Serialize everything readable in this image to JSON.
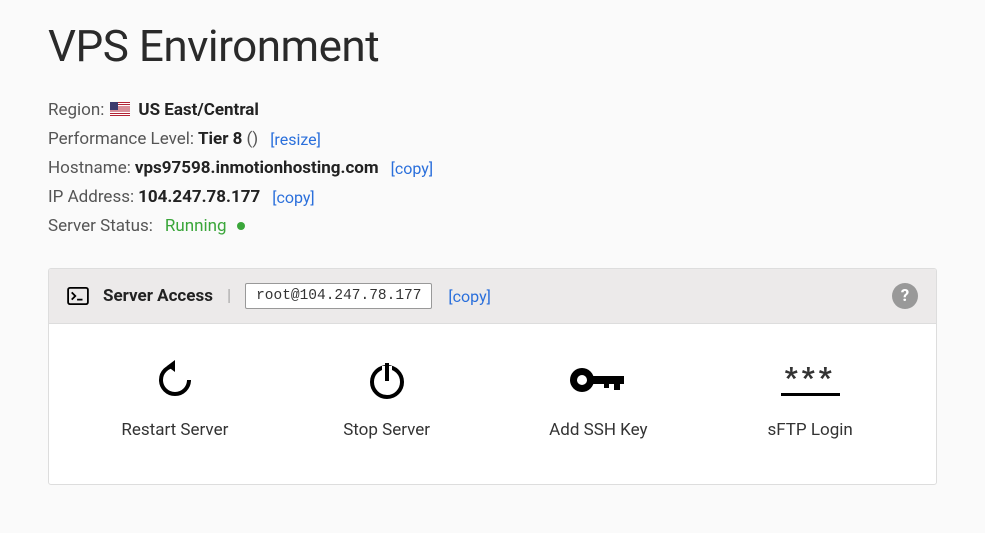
{
  "title": "VPS Environment",
  "details": {
    "region_label": "Region:",
    "region_value": "US East/Central",
    "perf_label": "Performance Level:",
    "perf_value": "Tier 8",
    "perf_extra": "()",
    "resize_link": "[resize]",
    "hostname_label": "Hostname:",
    "hostname_value": "vps97598.inmotionhosting.com",
    "hostname_copy": "[copy]",
    "ip_label": "IP Address:",
    "ip_value": "104.247.78.177",
    "ip_copy": "[copy]",
    "status_label": "Server Status:",
    "status_value": "Running"
  },
  "server_access": {
    "title": "Server Access",
    "divider": "|",
    "ssh": "root@104.247.78.177",
    "copy": "[copy]",
    "help": "?"
  },
  "actions": {
    "restart": "Restart Server",
    "stop": "Stop Server",
    "ssh_key": "Add SSH Key",
    "sftp": "sFTP Login",
    "sftp_stars": "***"
  }
}
